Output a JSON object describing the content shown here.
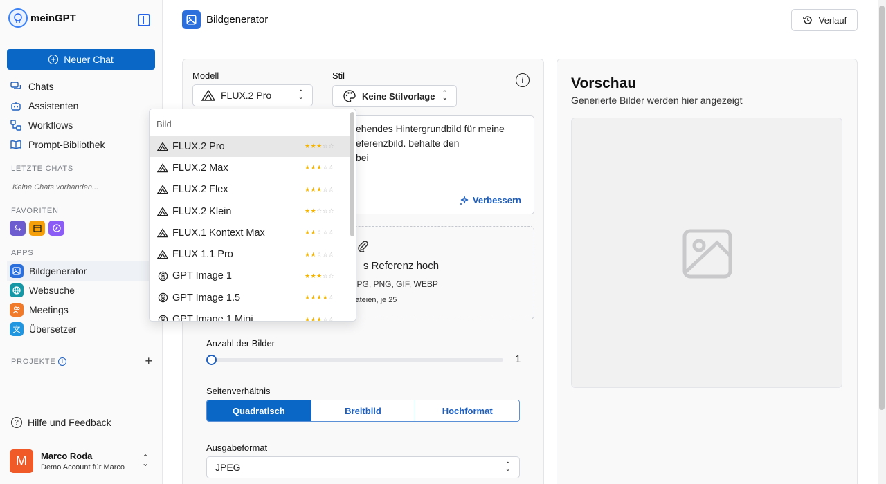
{
  "sidebar": {
    "brand": "meinGPT",
    "new_chat": "Neuer Chat",
    "nav": [
      {
        "label": "Chats",
        "icon": "chats-icon"
      },
      {
        "label": "Assistenten",
        "icon": "robot-icon"
      },
      {
        "label": "Workflows",
        "icon": "workflow-icon"
      },
      {
        "label": "Prompt-Bibliothek",
        "icon": "book-icon"
      }
    ],
    "recent_label": "LETZTE CHATS",
    "recent_empty": "Keine Chats vorhanden...",
    "favorites_label": "FAVORITEN",
    "favorites": [
      {
        "icon": "swap-icon",
        "color": "#6d5bd0"
      },
      {
        "icon": "calendar-icon",
        "color": "#f59f0b"
      },
      {
        "icon": "compass-icon",
        "color": "#8b5cf6"
      }
    ],
    "apps_label": "APPS",
    "apps": [
      {
        "label": "Bildgenerator",
        "icon": "image-icon",
        "color": "#2a6fdb",
        "active": true
      },
      {
        "label": "Websuche",
        "icon": "globe-icon",
        "color": "#1597a5",
        "active": false
      },
      {
        "label": "Meetings",
        "icon": "people-icon",
        "color": "#f07a2a",
        "active": false
      },
      {
        "label": "Übersetzer",
        "icon": "translate-icon",
        "color": "#2196e0",
        "active": false
      }
    ],
    "projects_label": "PROJEKTE",
    "help": "Hilfe und Feedback",
    "user": {
      "initial": "M",
      "name": "Marco Roda",
      "subtitle": "Demo Account für Marco"
    }
  },
  "header": {
    "title": "Bildgenerator",
    "history": "Verlauf"
  },
  "form": {
    "model_label": "Modell",
    "model_value": "FLUX.2 Pro",
    "style_label": "Stil",
    "style_value": "Keine Stilvorlage",
    "prompt_lines": [
      "ehendes Hintergrundbild für meine",
      "eferenzbild. behalte den",
      "bei"
    ],
    "improve": "Verbessern",
    "upload_title": "s Referenz hoch",
    "upload_formats": "e: JPG, PNG, GIF, WEBP",
    "upload_limit": "Dateien, je 25",
    "count_label": "Anzahl der Bilder",
    "count_value": "1",
    "count_fraction": 0,
    "ratio_label": "Seitenverhältnis",
    "ratio_options": [
      "Quadratisch",
      "Breitbild",
      "Hochformat"
    ],
    "ratio_selected": 0,
    "format_label": "Ausgabeformat",
    "format_value": "JPEG"
  },
  "preview": {
    "title": "Vorschau",
    "subtitle": "Generierte Bilder werden hier angezeigt"
  },
  "dropdown": {
    "group": "Bild",
    "items": [
      {
        "label": "FLUX.2 Pro",
        "icon": "flux-icon",
        "rating": 3,
        "selected": true
      },
      {
        "label": "FLUX.2 Max",
        "icon": "flux-icon",
        "rating": 3,
        "selected": false
      },
      {
        "label": "FLUX.2 Flex",
        "icon": "flux-icon",
        "rating": 3,
        "selected": false
      },
      {
        "label": "FLUX.2 Klein",
        "icon": "flux-icon",
        "rating": 2,
        "selected": false
      },
      {
        "label": "FLUX.1 Kontext Max",
        "icon": "flux-icon",
        "rating": 2,
        "selected": false
      },
      {
        "label": "FLUX 1.1 Pro",
        "icon": "flux-icon",
        "rating": 2,
        "selected": false
      },
      {
        "label": "GPT Image 1",
        "icon": "openai-icon",
        "rating": 3,
        "selected": false
      },
      {
        "label": "GPT Image 1.5",
        "icon": "openai-icon",
        "rating": 4,
        "selected": false
      },
      {
        "label": "GPT Image 1 Mini",
        "icon": "openai-icon",
        "rating": 3,
        "selected": false
      }
    ],
    "max_rating": 5
  }
}
